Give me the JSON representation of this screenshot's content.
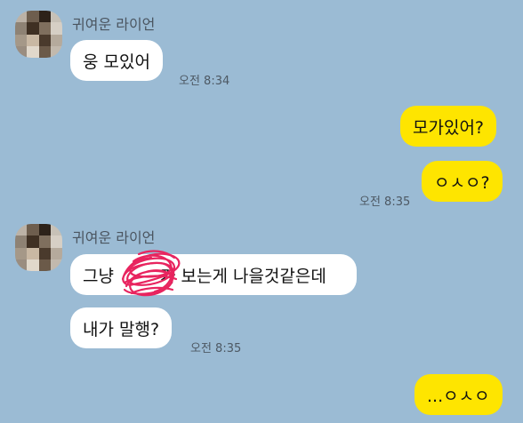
{
  "messages": [
    {
      "sender": "귀여운 라이언",
      "text": "웅 모있어",
      "time": "오전 8:34"
    },
    {
      "sender": "me",
      "text": "모가있어?"
    },
    {
      "sender": "me",
      "text": "ㅇㅅㅇ?",
      "time": "오전 8:35"
    },
    {
      "sender": "귀여운 라이언",
      "text": "그냥 [redacted] 보는게 나을것같은데"
    },
    {
      "sender": "귀여운 라이언",
      "text": "내가 말행?",
      "time": "오전 8:35"
    },
    {
      "sender": "me",
      "text": "...ㅇㅅㅇ"
    }
  ],
  "m3_before": "그냥",
  "m3_after": "가 보는게 나을것같은데",
  "colors": {
    "background": "#9bbbd4",
    "incoming": "#ffffff",
    "outgoing": "#fee500",
    "scribble": "#e8245f"
  }
}
